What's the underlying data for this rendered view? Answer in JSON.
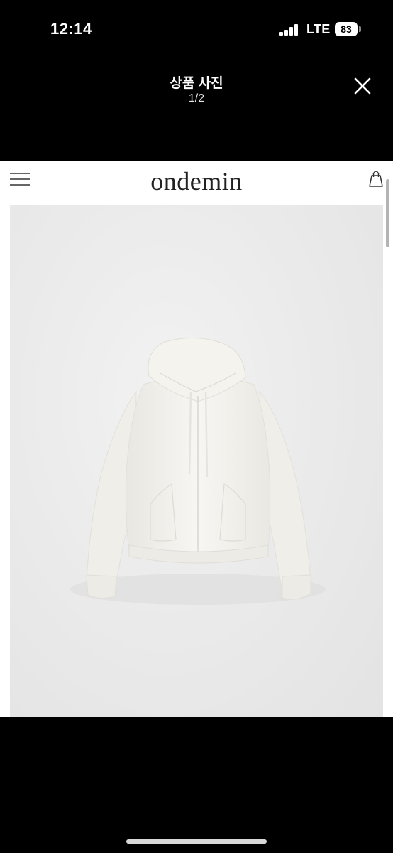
{
  "status_bar": {
    "time": "12:14",
    "carrier": "LTE",
    "battery": "83",
    "icons": [
      "signal-icon",
      "battery-icon"
    ]
  },
  "viewer": {
    "title": "상품 사진",
    "counter": "1/2",
    "close_icon": "close-icon"
  },
  "page": {
    "brand": "ondemin",
    "menu_icon": "hamburger-menu-icon",
    "cart_icon": "shopping-bag-icon",
    "product_image": "cropped-hooded-zip-up-jacket-ivory"
  },
  "colors": {
    "background": "#000000",
    "content_bg": "#ffffff",
    "photo_bg": "#e8e8e8",
    "garment": "#f4f3ef"
  }
}
